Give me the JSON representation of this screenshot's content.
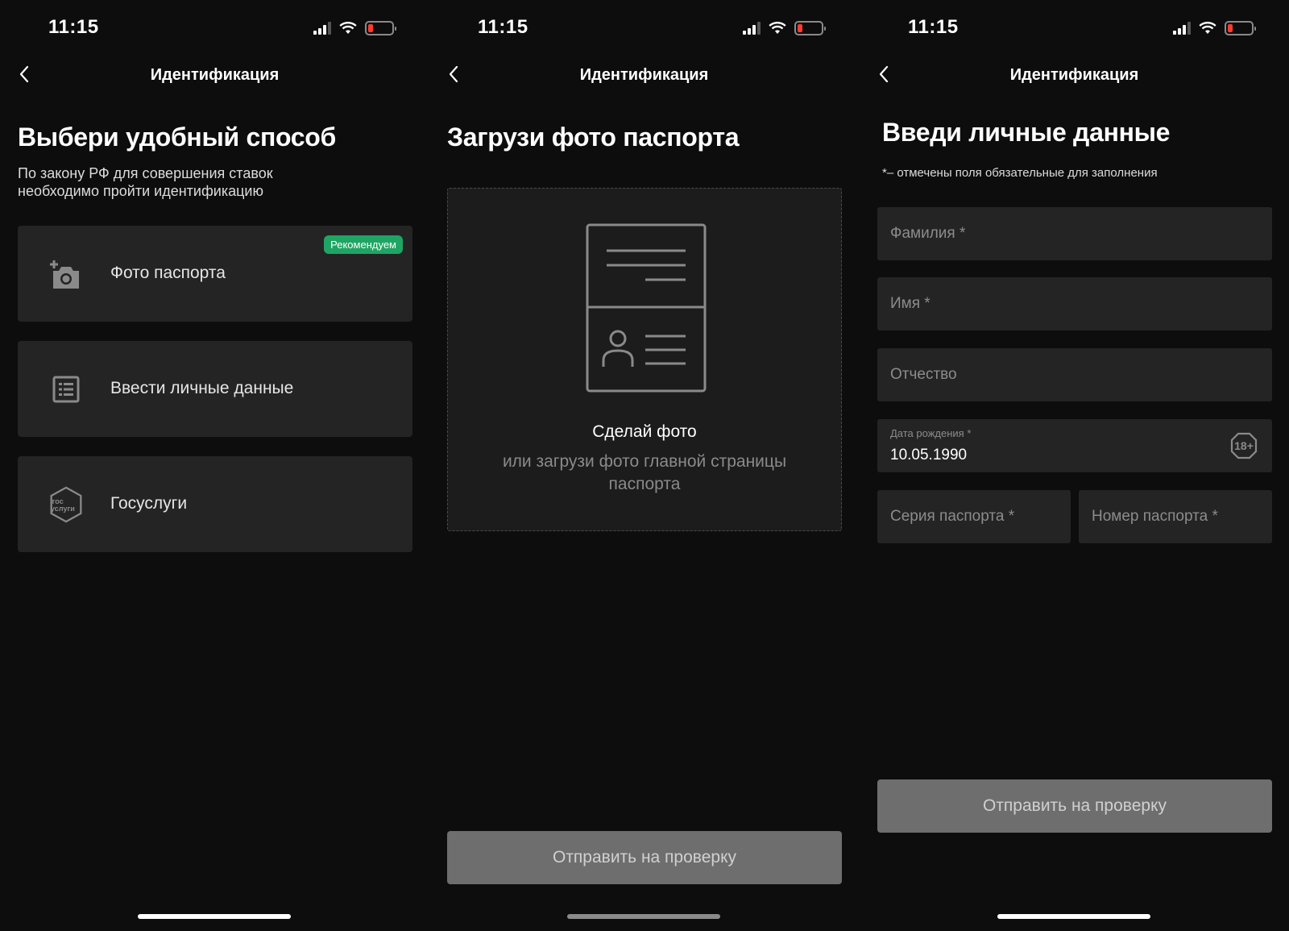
{
  "status": {
    "time": "11:15"
  },
  "screens": [
    {
      "nav_title": "Идентификация",
      "heading": "Выбери удобный способ",
      "subtitle": "По закону РФ для совершения ставок необходимо пройти идентификацию",
      "options": [
        {
          "label": "Фото паспорта",
          "icon": "add-camera-icon",
          "badge": "Рекомендуем"
        },
        {
          "label": "Ввести личные данные",
          "icon": "form-list-icon"
        },
        {
          "label": "Госуслуги",
          "icon": "gosuslugi-icon",
          "icon_text_1": "гос",
          "icon_text_2": "услуги"
        }
      ]
    },
    {
      "nav_title": "Идентификация",
      "heading": "Загрузи фото паспорта",
      "upload": {
        "title": "Сделай фото",
        "hint": "или загрузи фото главной страницы паспорта"
      },
      "submit_label": "Отправить на проверку"
    },
    {
      "nav_title": "Идентификация",
      "heading": "Введи личные данные",
      "note": "*– отмечены поля обязательные для заполнения",
      "fields": {
        "last_name": "Фамилия *",
        "first_name": "Имя *",
        "patronymic": "Отчество",
        "birth_label": "Дата рождения *",
        "birth_value": "10.05.1990",
        "age_badge": "18+",
        "passport_series": "Серия паспорта *",
        "passport_number": "Номер паспорта *"
      },
      "submit_label": "Отправить на проверку"
    }
  ],
  "colors": {
    "background": "#0d0d0d",
    "card": "#242424",
    "accent_green": "#1fa563",
    "button_disabled": "#6e6e6e"
  }
}
